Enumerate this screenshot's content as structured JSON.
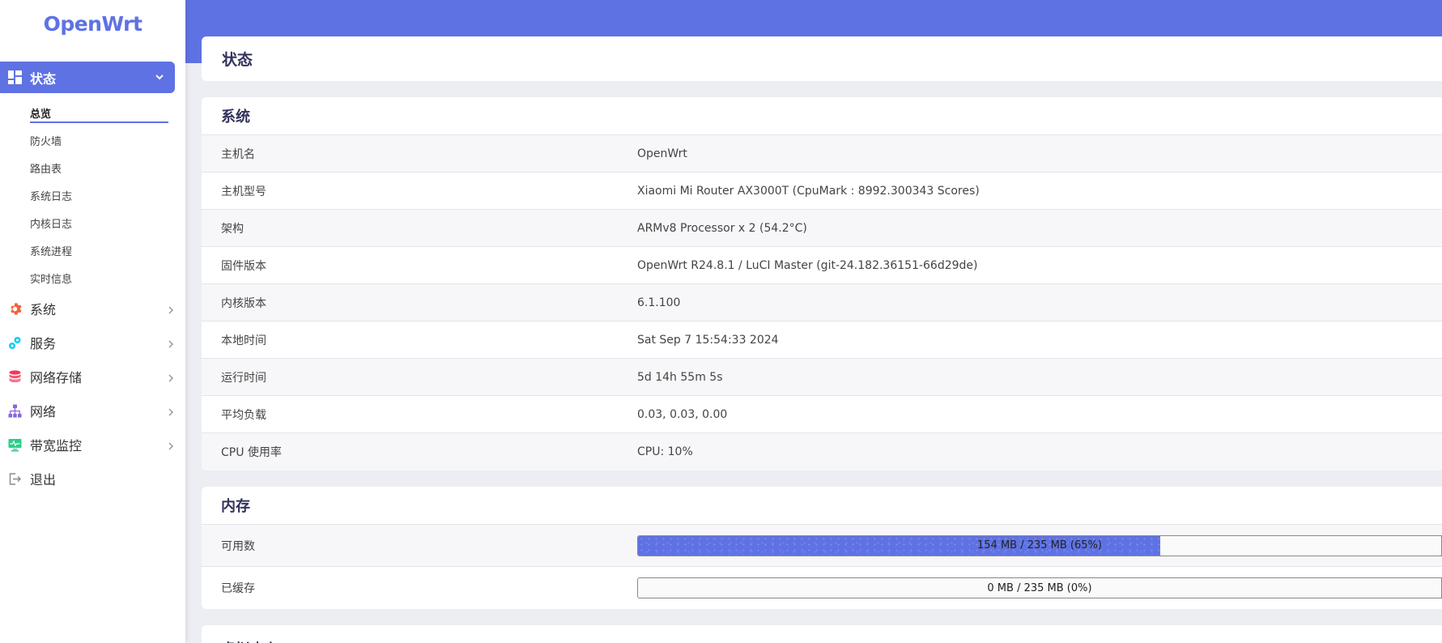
{
  "brand": "OpenWrt",
  "sidebar": {
    "active": {
      "label": "状态",
      "icon": "dashboard-icon"
    },
    "sub_items": [
      {
        "label": "总览",
        "active": true
      },
      {
        "label": "防火墙"
      },
      {
        "label": "路由表"
      },
      {
        "label": "系统日志"
      },
      {
        "label": "内核日志"
      },
      {
        "label": "系统进程"
      },
      {
        "label": "实时信息"
      }
    ],
    "items": [
      {
        "label": "系统",
        "icon": "gear-icon",
        "color": "#f5603a"
      },
      {
        "label": "服务",
        "icon": "services-icon",
        "color": "#11cdef"
      },
      {
        "label": "网络存储",
        "icon": "database-icon",
        "color": "#f5365c"
      },
      {
        "label": "网络",
        "icon": "network-icon",
        "color": "#8965e0"
      },
      {
        "label": "带宽监控",
        "icon": "monitor-icon",
        "color": "#2dce89"
      },
      {
        "label": "退出",
        "icon": "logout-icon",
        "color": "#888888"
      }
    ]
  },
  "page_title": "状态",
  "system": {
    "title": "系统",
    "rows": [
      {
        "key": "主机名",
        "value": "OpenWrt"
      },
      {
        "key": "主机型号",
        "value": "Xiaomi Mi Router AX3000T (CpuMark : 8992.300343 Scores)"
      },
      {
        "key": "架构",
        "value": "ARMv8 Processor x 2 (54.2°C)"
      },
      {
        "key": "固件版本",
        "value": "OpenWrt R24.8.1 / LuCI Master (git-24.182.36151-66d29de)"
      },
      {
        "key": "内核版本",
        "value": "6.1.100"
      },
      {
        "key": "本地时间",
        "value": "Sat Sep 7 15:54:33 2024"
      },
      {
        "key": "运行时间",
        "value": "5d 14h 55m 5s"
      },
      {
        "key": "平均负载",
        "value": "0.03, 0.03, 0.00"
      },
      {
        "key": "CPU 使用率",
        "value": "CPU: 10%"
      }
    ]
  },
  "memory": {
    "title": "内存",
    "rows": [
      {
        "key": "可用数",
        "text": "154 MB / 235 MB (65%)",
        "percent": 65
      },
      {
        "key": "已缓存",
        "text": "0 MB / 235 MB (0%)",
        "percent": 0
      }
    ]
  },
  "next_section_title": "虚拟内存",
  "colors": {
    "accent": "#5e72e4"
  }
}
